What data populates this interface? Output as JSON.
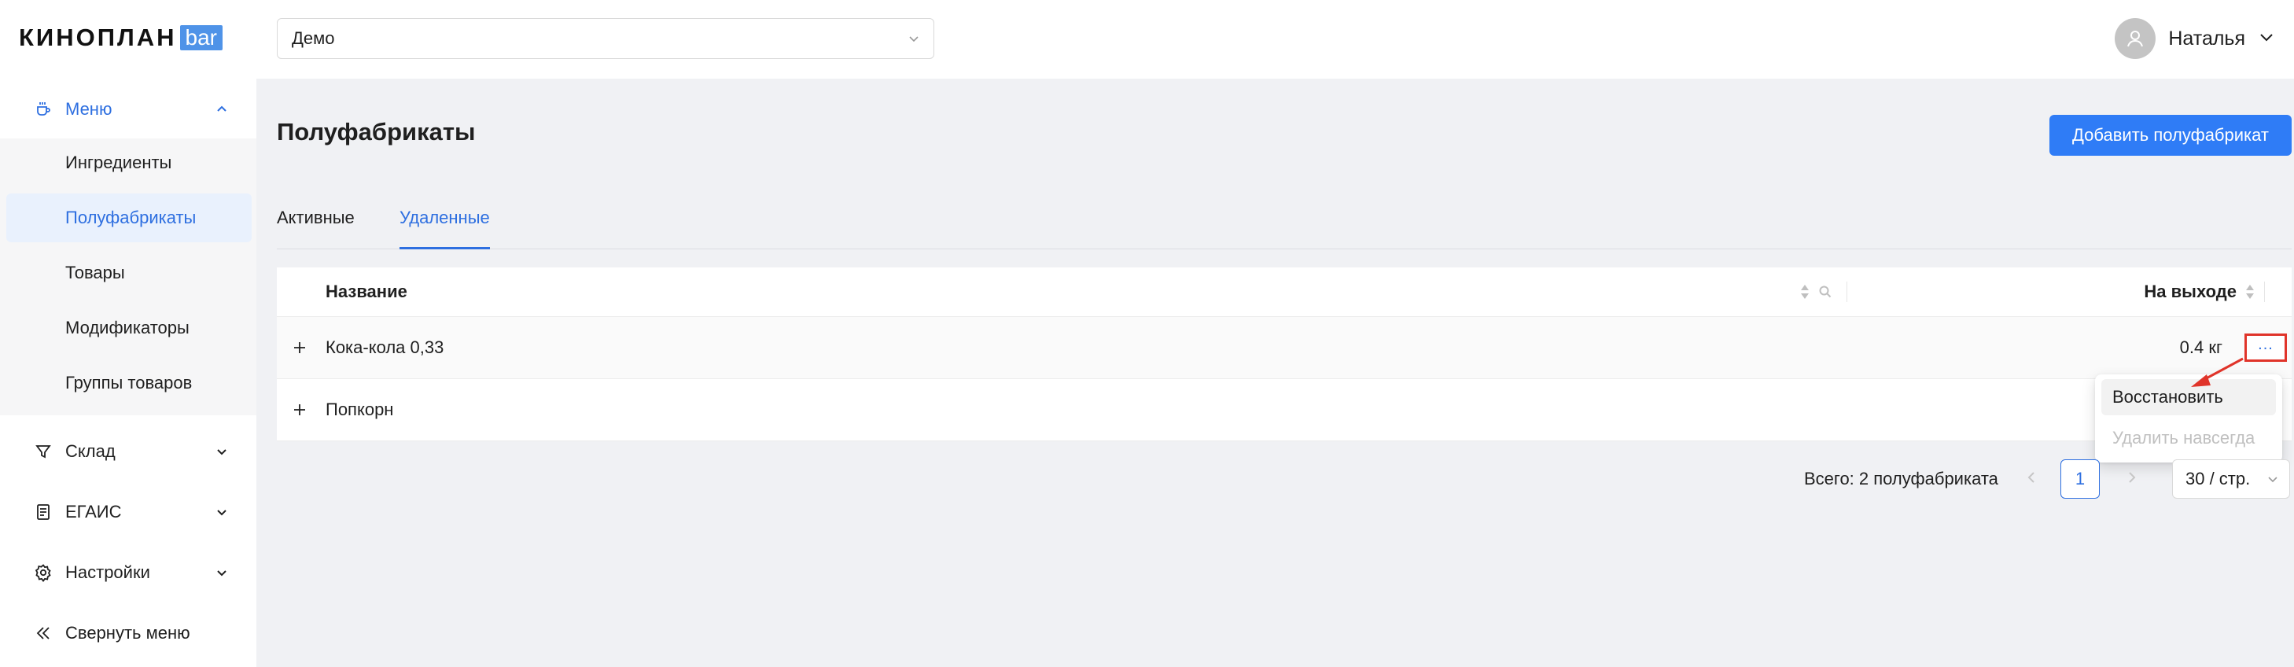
{
  "brand": {
    "name": "КИНОПЛАН",
    "badge": "bar"
  },
  "sidebar": {
    "menu": {
      "label": "Меню",
      "icon": "cup-icon"
    },
    "submenu": [
      {
        "label": "Ингредиенты"
      },
      {
        "label": "Полуфабрикаты"
      },
      {
        "label": "Товары"
      },
      {
        "label": "Модификаторы"
      },
      {
        "label": "Группы товаров"
      }
    ],
    "sections": [
      {
        "label": "Склад",
        "icon": "filter-icon"
      },
      {
        "label": "ЕГАИС",
        "icon": "document-icon"
      },
      {
        "label": "Настройки",
        "icon": "gear-icon"
      }
    ],
    "collapse": {
      "label": "Свернуть меню",
      "icon": "double-chevron-left-icon"
    }
  },
  "header": {
    "selector_value": "Демо",
    "user_name": "Наталья"
  },
  "page": {
    "title": "Полуфабрикаты",
    "add_button": "Добавить полуфабрикат",
    "tabs": [
      {
        "label": "Активные"
      },
      {
        "label": "Удаленные"
      }
    ],
    "active_tab": "Удаленные"
  },
  "table": {
    "columns": {
      "name": "Название",
      "output": "На выходе"
    },
    "rows": [
      {
        "name": "Кока-кола 0,33",
        "output": "0.4 кг"
      },
      {
        "name": "Попкорн",
        "output": ""
      }
    ]
  },
  "row_menu": {
    "items": [
      {
        "label": "Восстановить",
        "disabled": false
      },
      {
        "label": "Удалить навсегда",
        "disabled": true
      }
    ]
  },
  "pagination": {
    "total": "Всего: 2 полуфабриката",
    "current": "1",
    "per_page": "30 / стр."
  },
  "colors": {
    "accent": "#2e6fe0",
    "button": "#2f7cf6",
    "annotation": "#e0342a"
  }
}
